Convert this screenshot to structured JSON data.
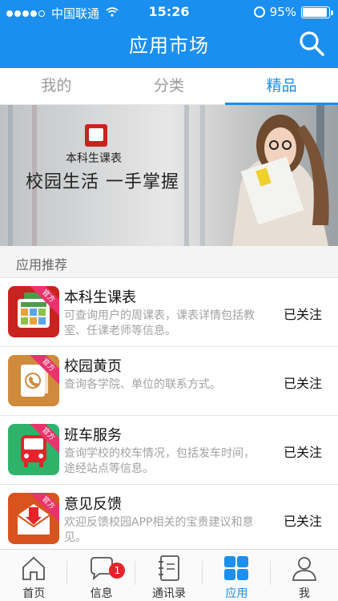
{
  "status": {
    "carrier": "中国联通",
    "time": "15:26",
    "battery_text": "95%",
    "battery_level": 0.95
  },
  "nav": {
    "title": "应用市场",
    "search_icon": "search-icon"
  },
  "tabs": [
    {
      "label": "我的",
      "active": false
    },
    {
      "label": "分类",
      "active": false
    },
    {
      "label": "精品",
      "active": true
    }
  ],
  "banner": {
    "brand": "本科生课表",
    "slogan": "校园生活 一手掌握"
  },
  "section": {
    "title": "应用推荐"
  },
  "apps": [
    {
      "title": "本科生课表",
      "desc": "可查询用户的周课表，课表详情包括教室、任课老师等信息。",
      "follow": "已关注",
      "ribbon": "官方",
      "icon_label": "课程表",
      "color": "#c8231e"
    },
    {
      "title": "校园黄页",
      "desc": "查询各学院、单位的联系方式。",
      "follow": "已关注",
      "ribbon": "官方",
      "color": "#d08a3c"
    },
    {
      "title": "班车服务",
      "desc": "查询学校的校车情况，包括发车时间，途经站点等信息。",
      "follow": "已关注",
      "ribbon": "官方",
      "color": "#2fb36b"
    },
    {
      "title": "意见反馈",
      "desc": "欢迎反馈校园APP相关的宝贵建议和意见。",
      "follow": "已关注",
      "ribbon": "官方",
      "color": "#d9531e"
    }
  ],
  "bottom_tabs": [
    {
      "label": "首页",
      "icon": "home-icon",
      "active": false
    },
    {
      "label": "信息",
      "icon": "message-icon",
      "active": false,
      "badge": "1"
    },
    {
      "label": "通讯录",
      "icon": "contacts-icon",
      "active": false
    },
    {
      "label": "应用",
      "icon": "apps-icon",
      "active": true
    },
    {
      "label": "我",
      "icon": "profile-icon",
      "active": false
    }
  ],
  "colors": {
    "primary": "#1a8ff0",
    "badge": "#e6232a",
    "ribbon": "#e8336b"
  }
}
